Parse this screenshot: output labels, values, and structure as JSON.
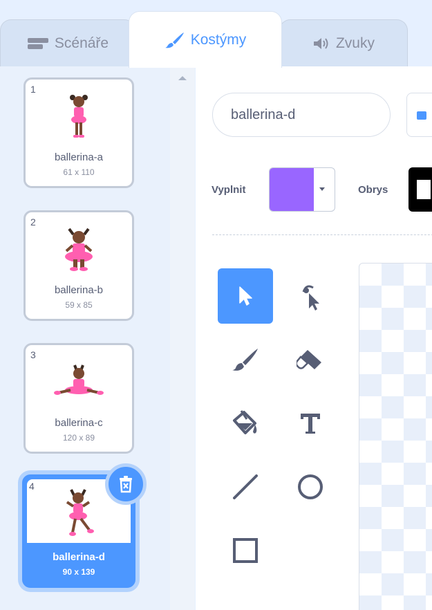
{
  "tabs": [
    {
      "label": "Scénáře",
      "icon": "code-icon",
      "active": false
    },
    {
      "label": "Kostýmy",
      "icon": "brush-icon",
      "active": true
    },
    {
      "label": "Zvuky",
      "icon": "speaker-icon",
      "active": false
    }
  ],
  "costumes": [
    {
      "number": "1",
      "name": "ballerina-a",
      "size": "61 x 110",
      "selected": false
    },
    {
      "number": "2",
      "name": "ballerina-b",
      "size": "59 x 85",
      "selected": false
    },
    {
      "number": "3",
      "name": "ballerina-c",
      "size": "120 x 89",
      "selected": false
    },
    {
      "number": "4",
      "name": "ballerina-d",
      "size": "90 x 139",
      "selected": true
    }
  ],
  "editor": {
    "costume_name": "ballerina-d",
    "fill_label": "Vyplnit",
    "fill_color": "#9966ff",
    "stroke_label": "Obrys",
    "stroke_color": "#000000"
  },
  "tools": [
    {
      "name": "select-tool",
      "icon": "arrow-pointer-icon",
      "active": true
    },
    {
      "name": "reshape-tool",
      "icon": "reshape-icon",
      "active": false
    },
    {
      "name": "brush-tool",
      "icon": "brush-icon",
      "active": false
    },
    {
      "name": "eraser-tool",
      "icon": "eraser-icon",
      "active": false
    },
    {
      "name": "fill-tool",
      "icon": "paint-bucket-icon",
      "active": false
    },
    {
      "name": "text-tool",
      "icon": "text-icon",
      "active": false
    },
    {
      "name": "line-tool",
      "icon": "line-icon",
      "active": false
    },
    {
      "name": "circle-tool",
      "icon": "circle-icon",
      "active": false
    },
    {
      "name": "rectangle-tool",
      "icon": "rectangle-icon",
      "active": false
    }
  ],
  "colors": {
    "accent": "#4c97ff",
    "text": "#575e75",
    "sidebar_bg": "#e9f1fc"
  }
}
